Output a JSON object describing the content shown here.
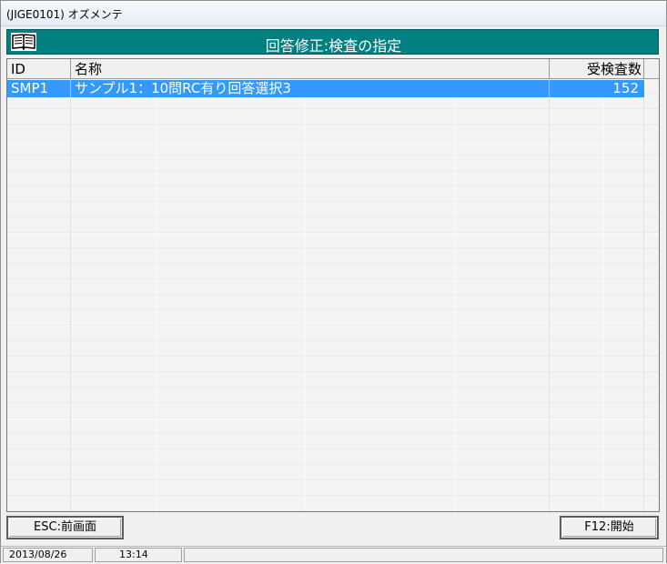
{
  "window": {
    "title": "(JIGE0101) オズメンテ"
  },
  "header": {
    "icon": "open-book-icon",
    "title": "回答修正:検査の指定"
  },
  "table": {
    "columns": [
      "ID",
      "名称",
      "受検査数"
    ],
    "rows": [
      {
        "id": "SMP1",
        "name": "サンプル1：10問RC有り回答選択3",
        "count": "152",
        "selected": true
      }
    ]
  },
  "buttons": {
    "back": "ESC:前画面",
    "start": "F12:開始"
  },
  "status": {
    "date": "2013/08/26",
    "time": "13:14",
    "extra": ""
  },
  "colors": {
    "header_band": "#008080",
    "selection": "#3399ff"
  }
}
